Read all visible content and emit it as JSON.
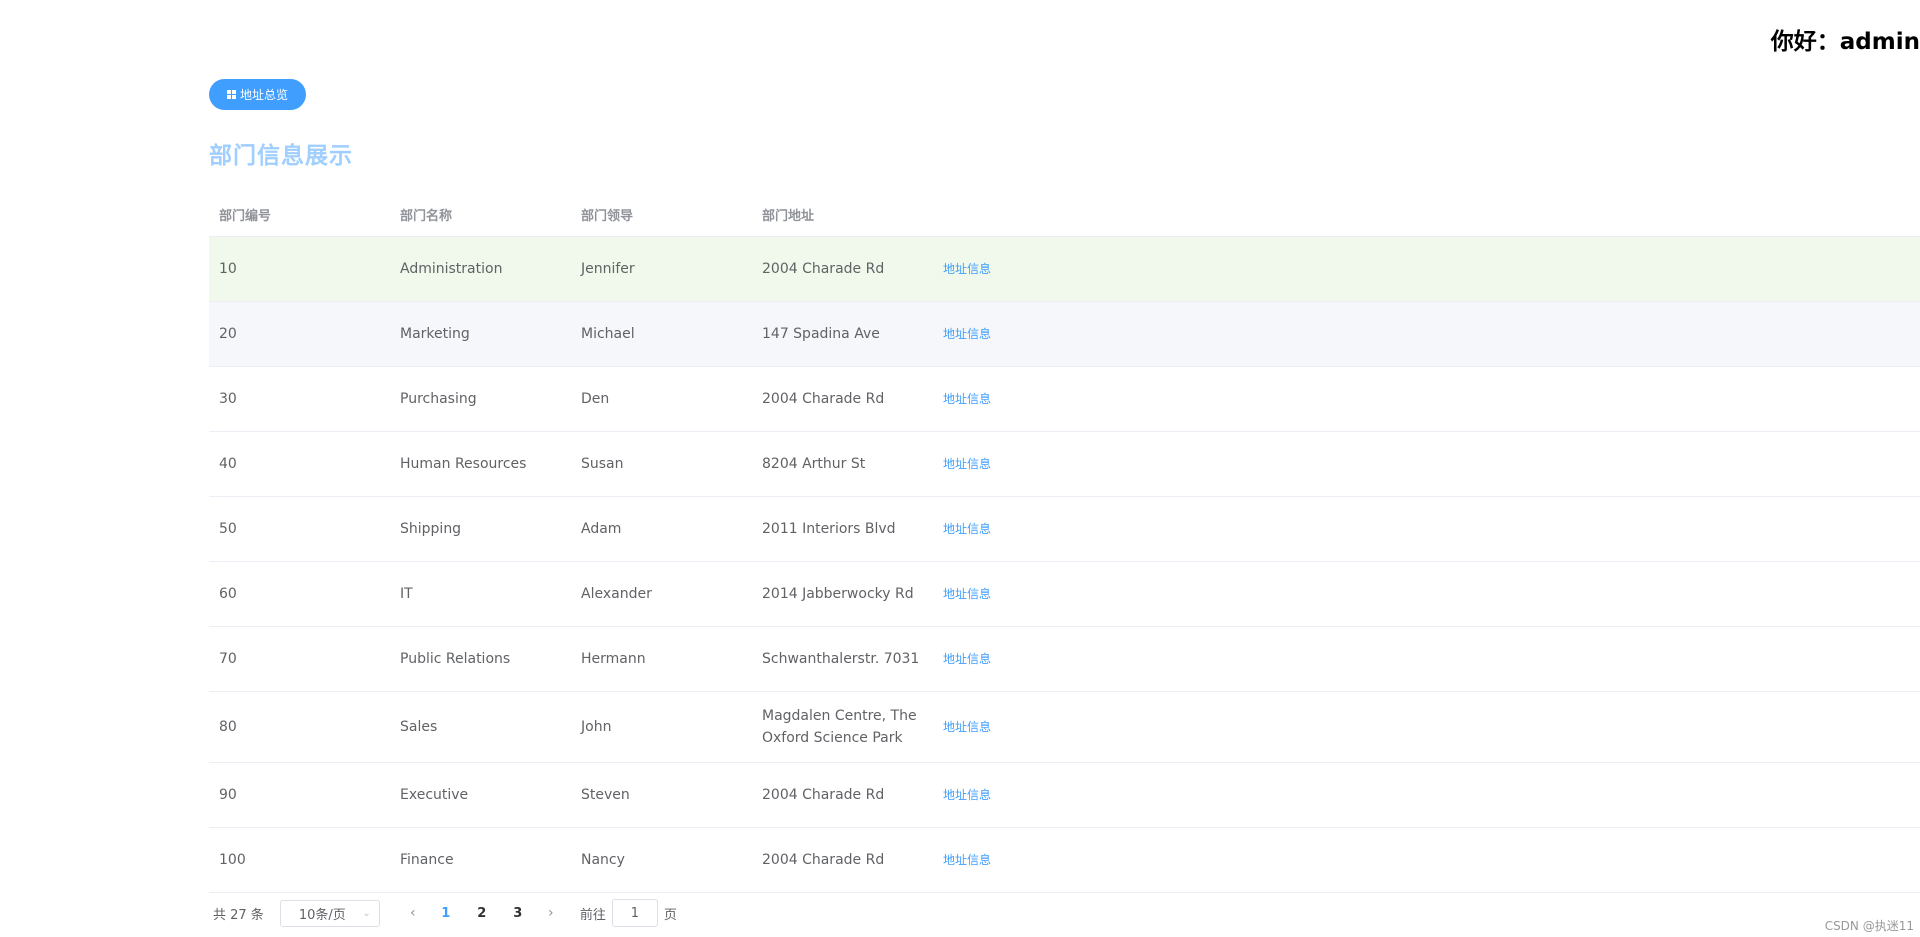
{
  "header": {
    "greeting": "你好：admin"
  },
  "toolbar": {
    "overview_label": "地址总览"
  },
  "page": {
    "title": "部门信息展示"
  },
  "table": {
    "columns": [
      "部门编号",
      "部门名称",
      "部门领导",
      "部门地址"
    ],
    "action_label": "地址信息",
    "rows": [
      {
        "id": "10",
        "name": "Administration",
        "leader": "Jennifer",
        "address": "2004 Charade Rd"
      },
      {
        "id": "20",
        "name": "Marketing",
        "leader": "Michael",
        "address": "147 Spadina Ave"
      },
      {
        "id": "30",
        "name": "Purchasing",
        "leader": "Den",
        "address": "2004 Charade Rd"
      },
      {
        "id": "40",
        "name": "Human Resources",
        "leader": "Susan",
        "address": "8204 Arthur St"
      },
      {
        "id": "50",
        "name": "Shipping",
        "leader": "Adam",
        "address": "2011 Interiors Blvd"
      },
      {
        "id": "60",
        "name": "IT",
        "leader": "Alexander",
        "address": "2014 Jabberwocky Rd"
      },
      {
        "id": "70",
        "name": "Public Relations",
        "leader": "Hermann",
        "address": "Schwanthalerstr. 7031"
      },
      {
        "id": "80",
        "name": "Sales",
        "leader": "John",
        "address": "Magdalen Centre, The Oxford Science Park"
      },
      {
        "id": "90",
        "name": "Executive",
        "leader": "Steven",
        "address": "2004 Charade Rd"
      },
      {
        "id": "100",
        "name": "Finance",
        "leader": "Nancy",
        "address": "2004 Charade Rd"
      }
    ]
  },
  "pagination": {
    "total_text": "共 27 条",
    "page_size": "10条/页",
    "prev_icon": "chevron-left-icon",
    "next_icon": "chevron-right-icon",
    "pages": [
      "1",
      "2",
      "3"
    ],
    "current_page": "1",
    "jump_prefix": "前往",
    "jump_value": "1",
    "jump_suffix": "页"
  },
  "watermark": "CSDN @执迷11",
  "colors": {
    "primary": "#409eff",
    "title": "#a0cfff",
    "row_hover": "#f0f9eb",
    "row_stripe": "#f5f7fa"
  }
}
